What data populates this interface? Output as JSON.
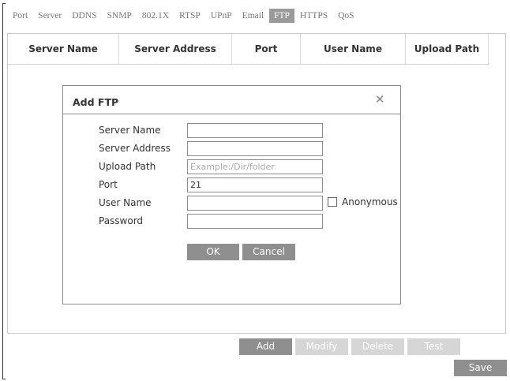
{
  "tabs": [
    {
      "label": "Port",
      "active": false
    },
    {
      "label": "Server",
      "active": false
    },
    {
      "label": "DDNS",
      "active": false
    },
    {
      "label": "SNMP",
      "active": false
    },
    {
      "label": "802.1X",
      "active": false
    },
    {
      "label": "RTSP",
      "active": false
    },
    {
      "label": "UPnP",
      "active": false
    },
    {
      "label": "Email",
      "active": false
    },
    {
      "label": "FTP",
      "active": true
    },
    {
      "label": "HTTPS",
      "active": false
    },
    {
      "label": "QoS",
      "active": false
    }
  ],
  "table": {
    "columns": [
      "Server Name",
      "Server Address",
      "Port",
      "User Name",
      "Upload Path"
    ],
    "rows": []
  },
  "dialog": {
    "title": "Add FTP",
    "close_icon": "close-icon",
    "fields": {
      "server_name": {
        "label": "Server Name",
        "value": "",
        "placeholder": ""
      },
      "server_address": {
        "label": "Server Address",
        "value": "",
        "placeholder": ""
      },
      "upload_path": {
        "label": "Upload Path",
        "value": "",
        "placeholder": "Example:/Dir/folder"
      },
      "port": {
        "label": "Port",
        "value": "21",
        "placeholder": ""
      },
      "user_name": {
        "label": "User Name",
        "value": "",
        "placeholder": ""
      },
      "password": {
        "label": "Password",
        "value": "",
        "placeholder": ""
      }
    },
    "anonymous": {
      "label": "Anonymous",
      "checked": false
    },
    "ok_label": "OK",
    "cancel_label": "Cancel"
  },
  "actions": {
    "add_label": "Add",
    "modify_label": "Modify",
    "delete_label": "Delete",
    "test_label": "Test",
    "save_label": "Save"
  },
  "colors": {
    "active_tab": "#9a9a9a",
    "button": "#8f8f8f",
    "button_disabled": "#d6d6d6"
  }
}
